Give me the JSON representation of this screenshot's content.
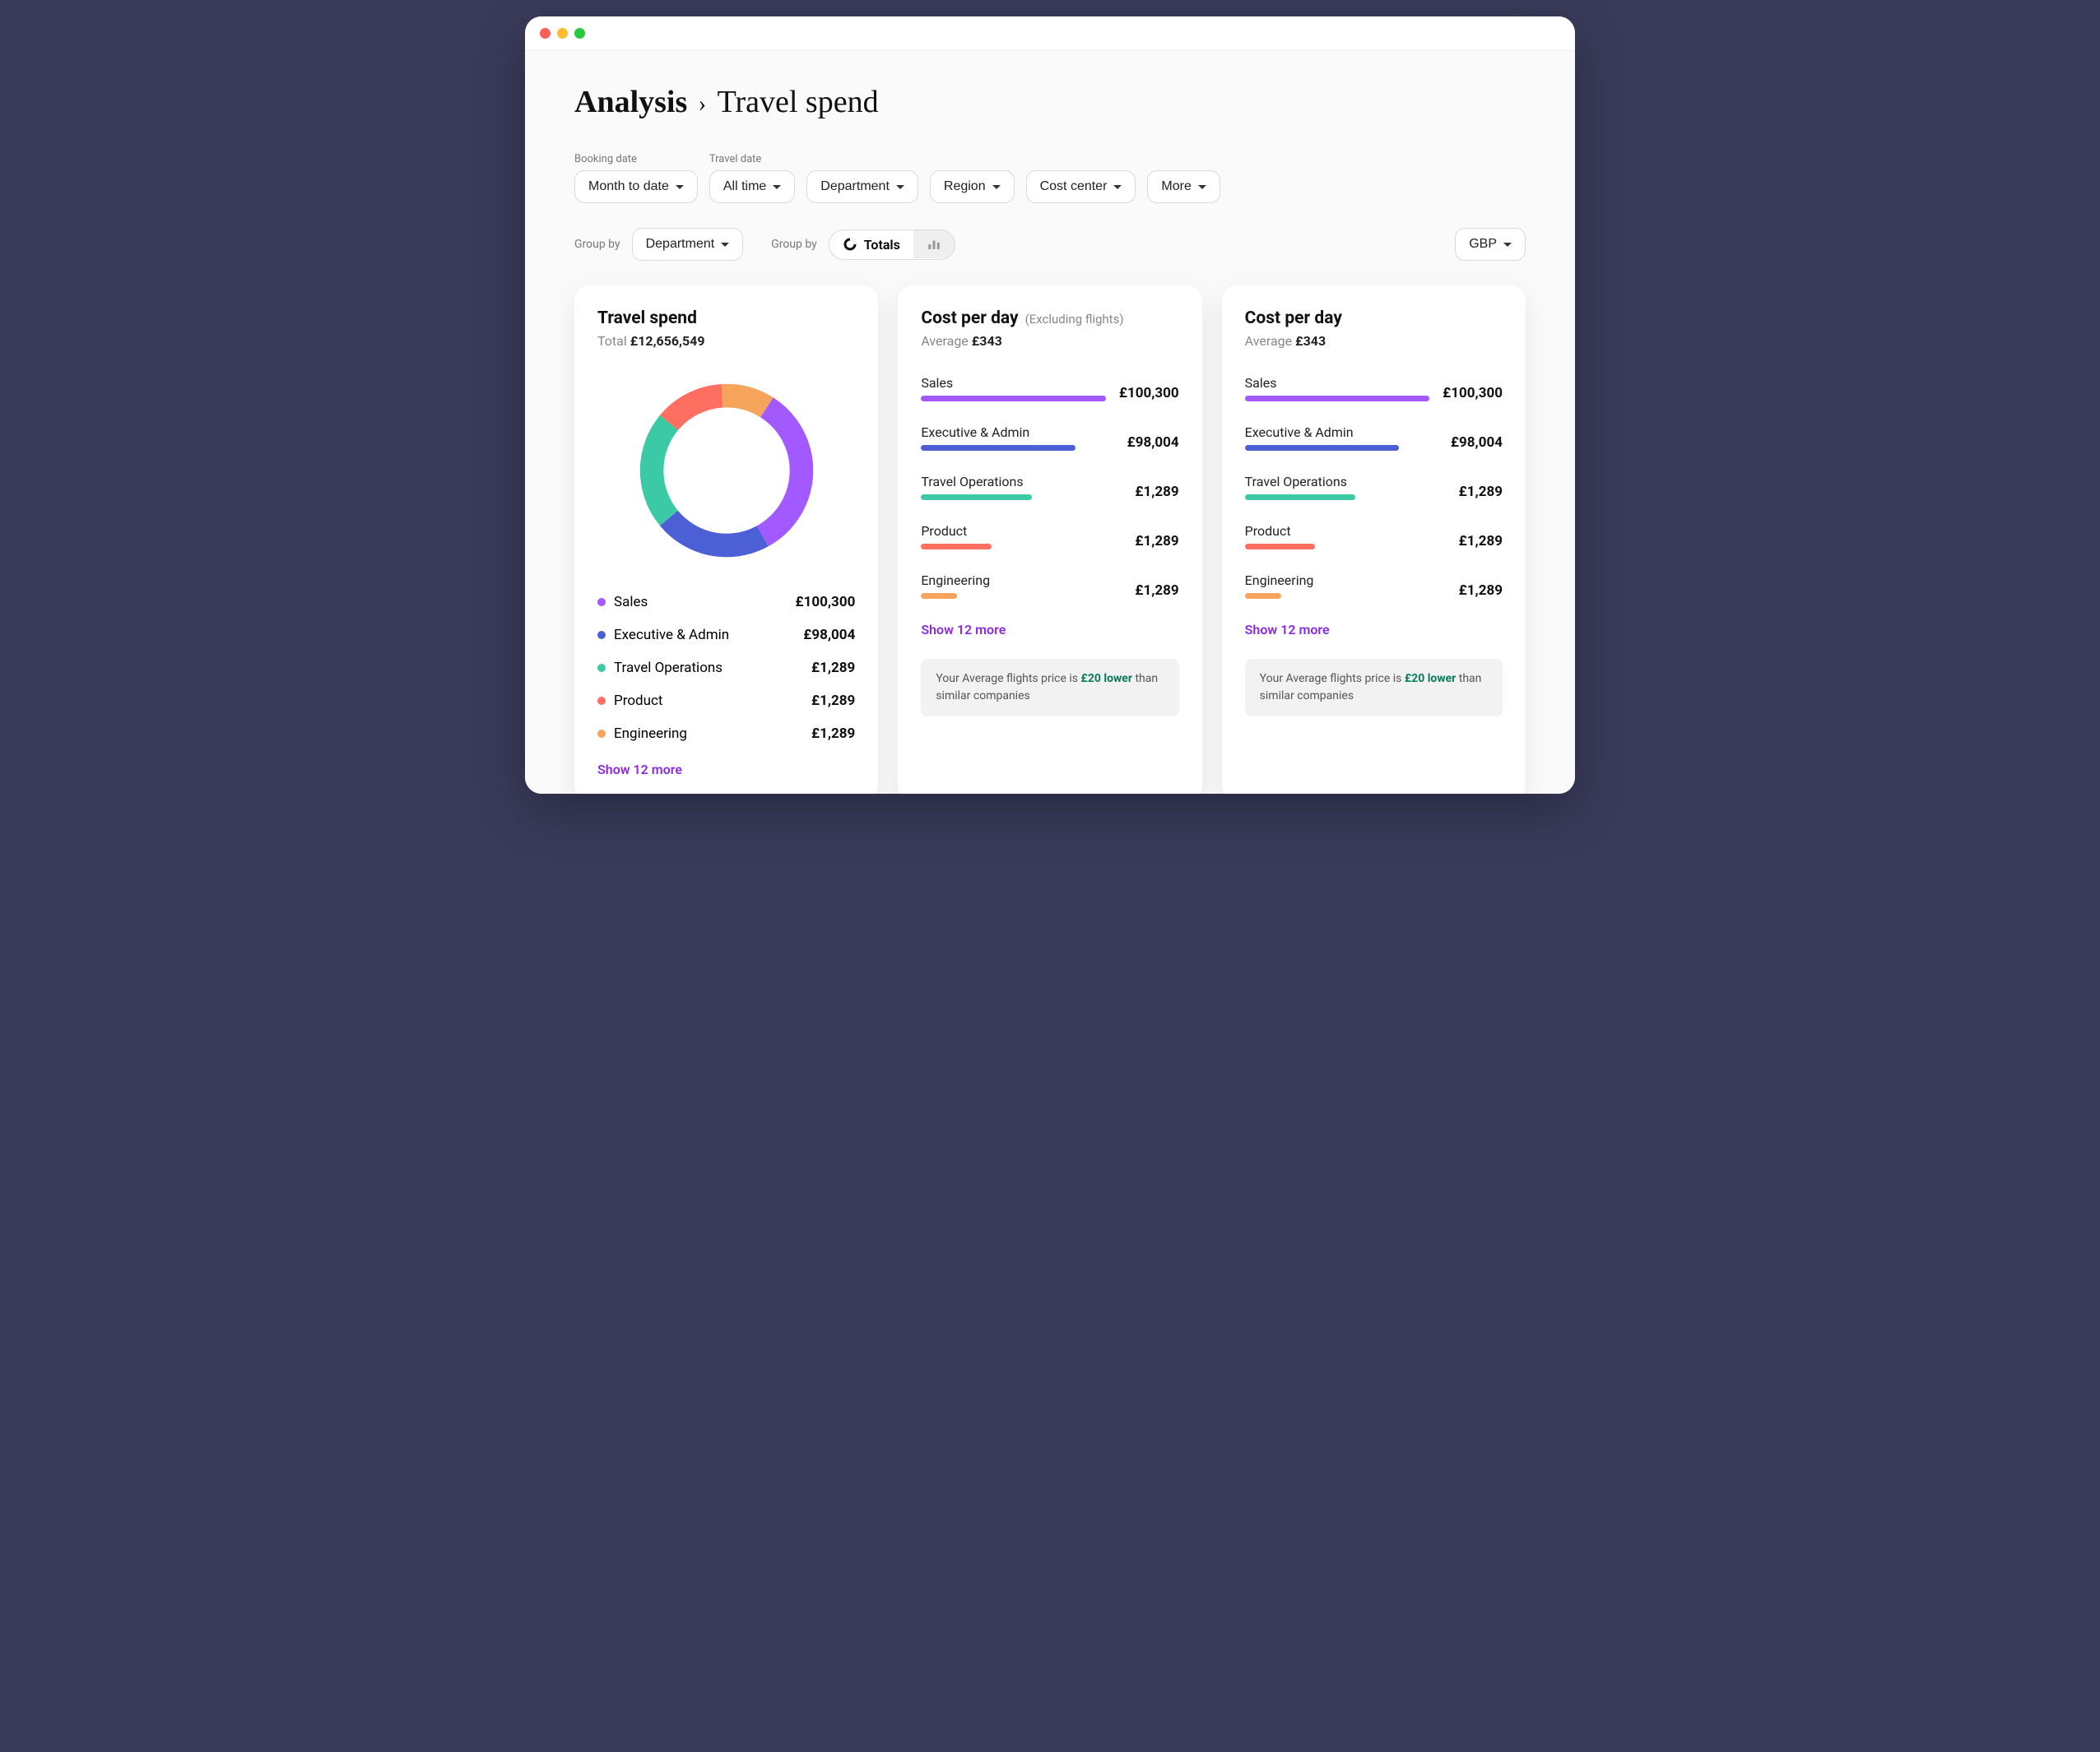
{
  "breadcrumb": {
    "root": "Analysis",
    "leaf": "Travel spend"
  },
  "filters": {
    "booking_date": {
      "label": "Booking date",
      "value": "Month to date"
    },
    "travel_date": {
      "label": "Travel date",
      "value": "All time"
    },
    "department": {
      "value": "Department"
    },
    "region": {
      "value": "Region"
    },
    "cost_center": {
      "value": "Cost center"
    },
    "more": {
      "value": "More"
    }
  },
  "controls": {
    "group_by_label": "Group by",
    "group_by_value": "Department",
    "view_label": "Group by",
    "view_totals": "Totals",
    "currency": "GBP"
  },
  "colors": {
    "sales": "#a259ff",
    "exec": "#4c5fd5",
    "travel_ops": "#3bc9a6",
    "product": "#ff6f61",
    "engineering": "#f6a45c"
  },
  "travel_spend": {
    "title": "Travel spend",
    "total_label": "Total",
    "total_value": "£12,656,549",
    "legend": [
      {
        "key": "sales",
        "label": "Sales",
        "value": "£100,300"
      },
      {
        "key": "exec",
        "label": "Executive & Admin",
        "value": "£98,004"
      },
      {
        "key": "travel_ops",
        "label": "Travel Operations",
        "value": "£1,289"
      },
      {
        "key": "product",
        "label": "Product",
        "value": "£1,289"
      },
      {
        "key": "engineering",
        "label": "Engineering",
        "value": "£1,289"
      }
    ],
    "show_more": "Show 12 more"
  },
  "cost_per_day_ex": {
    "title": "Cost per day",
    "subtitle": "(Excluding flights)",
    "avg_label": "Average",
    "avg_value": "£343",
    "rows": [
      {
        "key": "sales",
        "label": "Sales",
        "value": "£100,300",
        "width": 100
      },
      {
        "key": "exec",
        "label": "Executive & Admin",
        "value": "£98,004",
        "width": 80
      },
      {
        "key": "travel_ops",
        "label": "Travel Operations",
        "value": "£1,289",
        "width": 55
      },
      {
        "key": "product",
        "label": "Product",
        "value": "£1,289",
        "width": 35
      },
      {
        "key": "engineering",
        "label": "Engineering",
        "value": "£1,289",
        "width": 18
      }
    ],
    "show_more": "Show 12 more",
    "info_pre": "Your Average flights price is ",
    "info_hl": "£20 lower",
    "info_post": " than similar companies"
  },
  "cost_per_day": {
    "title": "Cost per day",
    "avg_label": "Average",
    "avg_value": "£343",
    "rows": [
      {
        "key": "sales",
        "label": "Sales",
        "value": "£100,300",
        "width": 100
      },
      {
        "key": "exec",
        "label": "Executive & Admin",
        "value": "£98,004",
        "width": 80
      },
      {
        "key": "travel_ops",
        "label": "Travel Operations",
        "value": "£1,289",
        "width": 55
      },
      {
        "key": "product",
        "label": "Product",
        "value": "£1,289",
        "width": 35
      },
      {
        "key": "engineering",
        "label": "Engineering",
        "value": "£1,289",
        "width": 18
      }
    ],
    "show_more": "Show 12 more",
    "info_pre": "Your Average flights price is ",
    "info_hl": "£20 lower",
    "info_post": " than similar companies"
  },
  "chart_data": {
    "type": "pie",
    "title": "Travel spend",
    "total": 12656549,
    "series": [
      {
        "name": "Sales",
        "value": 100300,
        "color": "#a259ff",
        "arc_share_pct": 33
      },
      {
        "name": "Executive & Admin",
        "value": 98004,
        "color": "#4c5fd5",
        "arc_share_pct": 22
      },
      {
        "name": "Travel Operations",
        "value": 1289,
        "color": "#3bc9a6",
        "arc_share_pct": 22
      },
      {
        "name": "Product",
        "value": 1289,
        "color": "#ff6f61",
        "arc_share_pct": 13
      },
      {
        "name": "Engineering",
        "value": 1289,
        "color": "#f6a45c",
        "arc_share_pct": 10
      }
    ]
  }
}
